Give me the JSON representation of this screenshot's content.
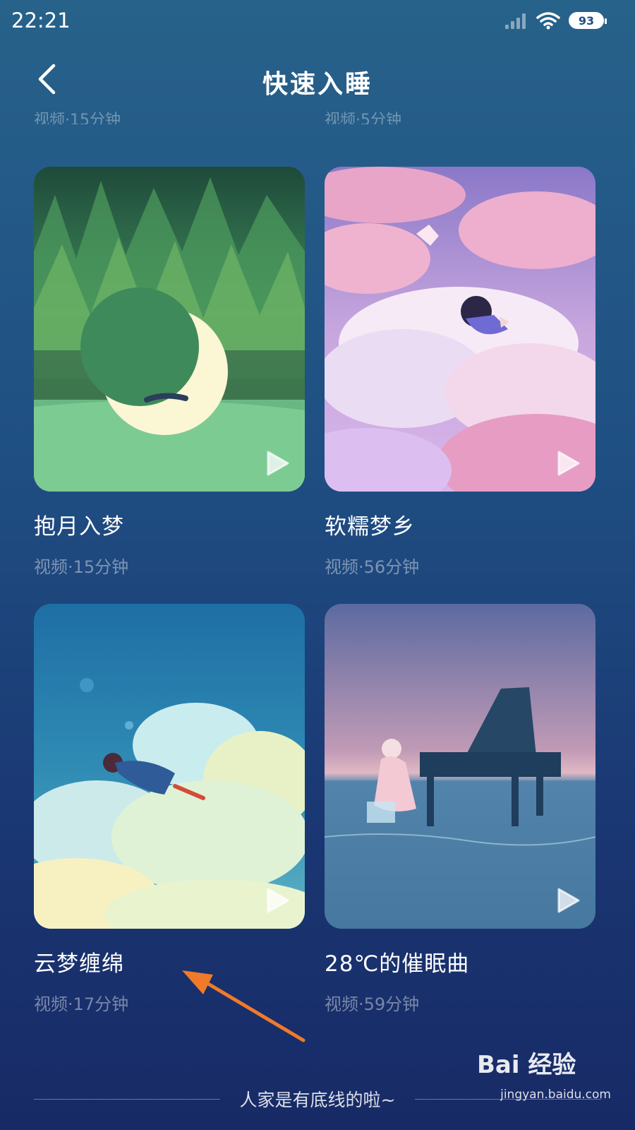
{
  "status_bar": {
    "time": "22:21",
    "battery": "93"
  },
  "header": {
    "title": "快速入睡"
  },
  "clipped_row": {
    "left_meta": "视频·15分钟",
    "right_meta": "视频·5分钟"
  },
  "cards": [
    {
      "title": "抱月入梦",
      "meta": "视频·15分钟"
    },
    {
      "title": "软糯梦乡",
      "meta": "视频·56分钟"
    },
    {
      "title": "云梦缠绵",
      "meta": "视频·17分钟"
    },
    {
      "title": "28℃的催眠曲",
      "meta": "视频·59分钟"
    }
  ],
  "footer": {
    "text": "人家是有底线的啦~"
  },
  "watermark": {
    "brand": "Bai  经验",
    "url": "jingyan.baidu.com"
  },
  "icons": {
    "back": "chevron-left-icon",
    "play": "play-icon",
    "signal": "signal-icon",
    "wifi": "wifi-icon"
  },
  "colors": {
    "arrow": "#f07a2a"
  }
}
